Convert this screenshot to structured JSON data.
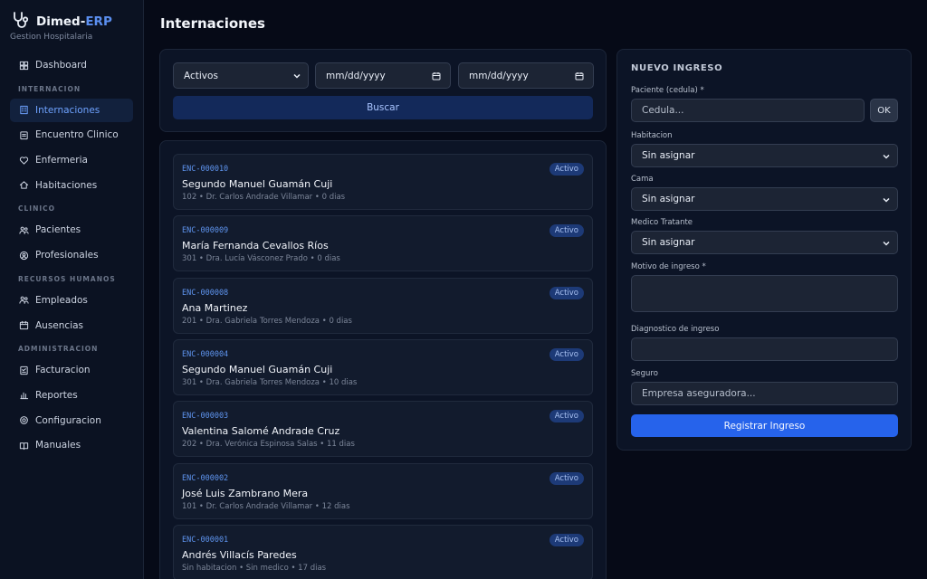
{
  "brand": {
    "name_part1": "Dimed-",
    "name_part2": "ERP",
    "subtitle": "Gestion Hospitalaria"
  },
  "sidebar": {
    "top": [
      {
        "label": "Dashboard",
        "icon": "grid-icon"
      }
    ],
    "sections": [
      {
        "title": "INTERNACION",
        "items": [
          {
            "label": "Internaciones",
            "icon": "building-icon",
            "active": true
          },
          {
            "label": "Encuentro Clinico",
            "icon": "clipboard-icon"
          },
          {
            "label": "Enfermeria",
            "icon": "heart-icon"
          },
          {
            "label": "Habitaciones",
            "icon": "home-icon"
          }
        ]
      },
      {
        "title": "CLINICO",
        "items": [
          {
            "label": "Pacientes",
            "icon": "users-icon"
          },
          {
            "label": "Profesionales",
            "icon": "user-circle-icon"
          }
        ]
      },
      {
        "title": "RECURSOS HUMANOS",
        "items": [
          {
            "label": "Empleados",
            "icon": "users-icon"
          },
          {
            "label": "Ausencias",
            "icon": "calendar-icon"
          }
        ]
      },
      {
        "title": "ADMINISTRACION",
        "items": [
          {
            "label": "Facturacion",
            "icon": "invoice-icon"
          },
          {
            "label": "Reportes",
            "icon": "bar-chart-icon"
          },
          {
            "label": "Configuracion",
            "icon": "gear-icon"
          },
          {
            "label": "Manuales",
            "icon": "book-icon"
          }
        ]
      }
    ]
  },
  "main": {
    "title": "Internaciones"
  },
  "filters": {
    "status_selected": "Activos",
    "date_from_placeholder": "mm/dd/yyyy",
    "date_to_placeholder": "mm/dd/yyyy",
    "search_label": "Buscar"
  },
  "encounters": [
    {
      "code": "ENC-000010",
      "patient": "Segundo Manuel Guamán Cuji",
      "details": "102 • Dr. Carlos Andrade Villamar • 0 dias",
      "status": "Activo"
    },
    {
      "code": "ENC-000009",
      "patient": "María Fernanda Cevallos Ríos",
      "details": "301 • Dra. Lucía Vásconez Prado • 0 dias",
      "status": "Activo"
    },
    {
      "code": "ENC-000008",
      "patient": "Ana Martinez",
      "details": "201 • Dra. Gabriela Torres Mendoza • 0 dias",
      "status": "Activo"
    },
    {
      "code": "ENC-000004",
      "patient": "Segundo Manuel Guamán Cuji",
      "details": "301 • Dra. Gabriela Torres Mendoza • 10 dias",
      "status": "Activo"
    },
    {
      "code": "ENC-000003",
      "patient": "Valentina Salomé Andrade Cruz",
      "details": "202 • Dra. Verónica Espinosa Salas • 11 dias",
      "status": "Activo"
    },
    {
      "code": "ENC-000002",
      "patient": "José Luis Zambrano Mera",
      "details": "101 • Dr. Carlos Andrade Villamar • 12 dias",
      "status": "Activo"
    },
    {
      "code": "ENC-000001",
      "patient": "Andrés Villacís Paredes",
      "details": "Sin habitacion • Sin medico • 17 dias",
      "status": "Activo"
    }
  ],
  "form": {
    "title": "NUEVO INGRESO",
    "patient_label": "Paciente (cedula) *",
    "patient_placeholder": "Cedula...",
    "ok_label": "OK",
    "room_label": "Habitacion",
    "room_value": "Sin asignar",
    "bed_label": "Cama",
    "bed_value": "Sin asignar",
    "doctor_label": "Medico Tratante",
    "doctor_value": "Sin asignar",
    "reason_label": "Motivo de ingreso *",
    "diagnosis_label": "Diagnostico de ingreso",
    "insurance_label": "Seguro",
    "insurance_placeholder": "Empresa aseguradora...",
    "submit_label": "Registrar Ingreso"
  }
}
